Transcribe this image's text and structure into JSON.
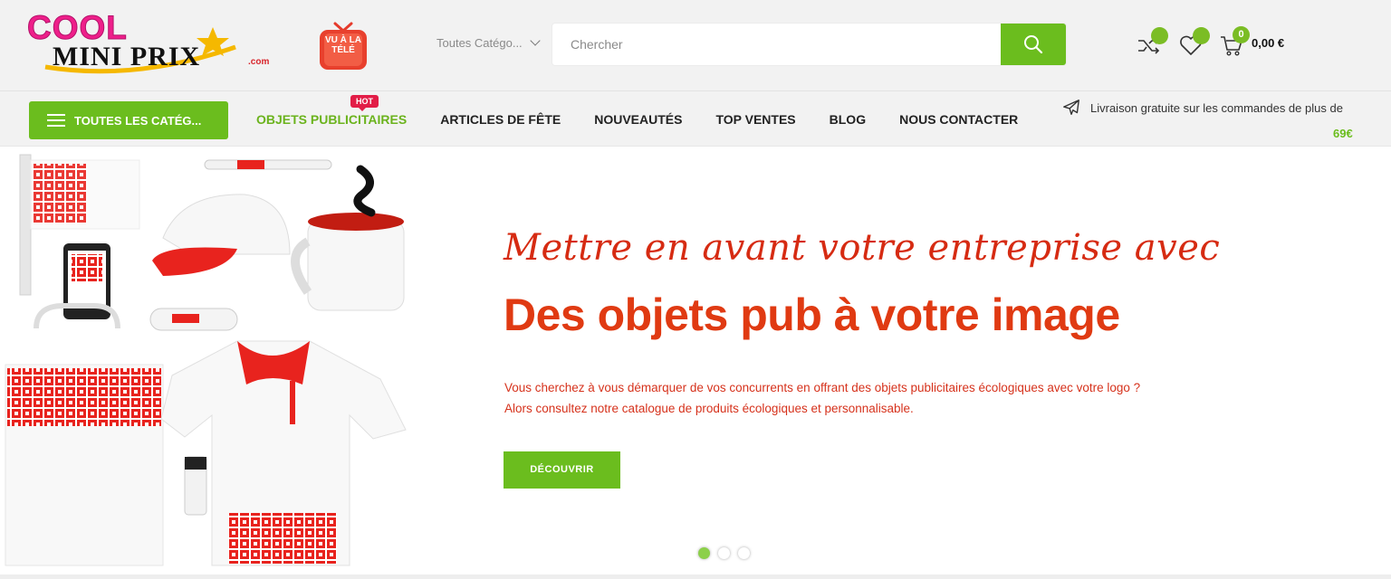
{
  "brand": {
    "logo_line1": "COOL",
    "logo_line2": "MINI PRIX",
    "logo_suffix": ".com",
    "tv_badge": "VU À LA TÉLÉ"
  },
  "header": {
    "category_select": "Toutes Catégo...",
    "search_placeholder": "Chercher",
    "compare_icon": "shuffle-icon",
    "wishlist_icon": "heart-icon",
    "cart_icon": "cart-icon",
    "cart_count": "0",
    "cart_total": "0,00 €"
  },
  "nav": {
    "all_categories": "TOUTES LES CATÉG...",
    "hot_badge": "HOT",
    "links": [
      "OBJETS PUBLICITAIRES",
      "ARTICLES DE FÊTE",
      "NOUVEAUTÉS",
      "TOP VENTES",
      "BLOG",
      "NOUS CONTACTER"
    ],
    "shipping_text": "Livraison gratuite sur les commandes de plus de",
    "shipping_amount": "69€"
  },
  "hero": {
    "tagline": "Mettre en avant votre entreprise avec",
    "title": "Des objets pub à votre image",
    "description_line1": "Vous cherchez à vous démarquer de vos concurrents en offrant des objets publicitaires écologiques avec votre logo ?",
    "description_line2": "Alors consultez notre catalogue de produits écologiques et personnalisable.",
    "cta": "DÉCOUVRIR",
    "slides": 3,
    "active_slide": 1
  },
  "colors": {
    "accent_green": "#6bbd1e",
    "headline_red": "#e03a12",
    "brand_pink": "#ee1f8a",
    "hot_red": "#e21d47"
  }
}
